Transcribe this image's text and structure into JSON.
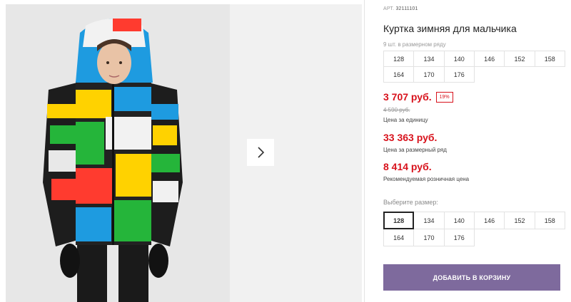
{
  "product": {
    "article_label": "АРТ.",
    "article": "32111101",
    "title": "Куртка зимняя для мальчика",
    "size_note": "9 шт. в размерном ряду",
    "size_row": [
      "128",
      "134",
      "140",
      "146",
      "152",
      "158",
      "164",
      "170",
      "176"
    ],
    "price": "3 707 руб.",
    "discount": "19%",
    "old_price": "4 590 руб.",
    "unit_label": "Цена за единицу",
    "row_price": "33 363 руб.",
    "row_label": "Цена за размерный ряд",
    "retail_price": "8 414 руб.",
    "retail_label": "Рекомендуемая розничная цена",
    "choose_label": "Выберите размер:",
    "sizes": [
      "128",
      "134",
      "140",
      "146",
      "152",
      "158",
      "164",
      "170",
      "176"
    ],
    "selected_size": "128",
    "add_to_cart": "ДОБАВИТЬ В КОРЗИНУ"
  },
  "colors": {
    "accent": "#7e6a9d",
    "price_red": "#d8121c"
  },
  "icons": {
    "next": "chevron-right-icon"
  }
}
